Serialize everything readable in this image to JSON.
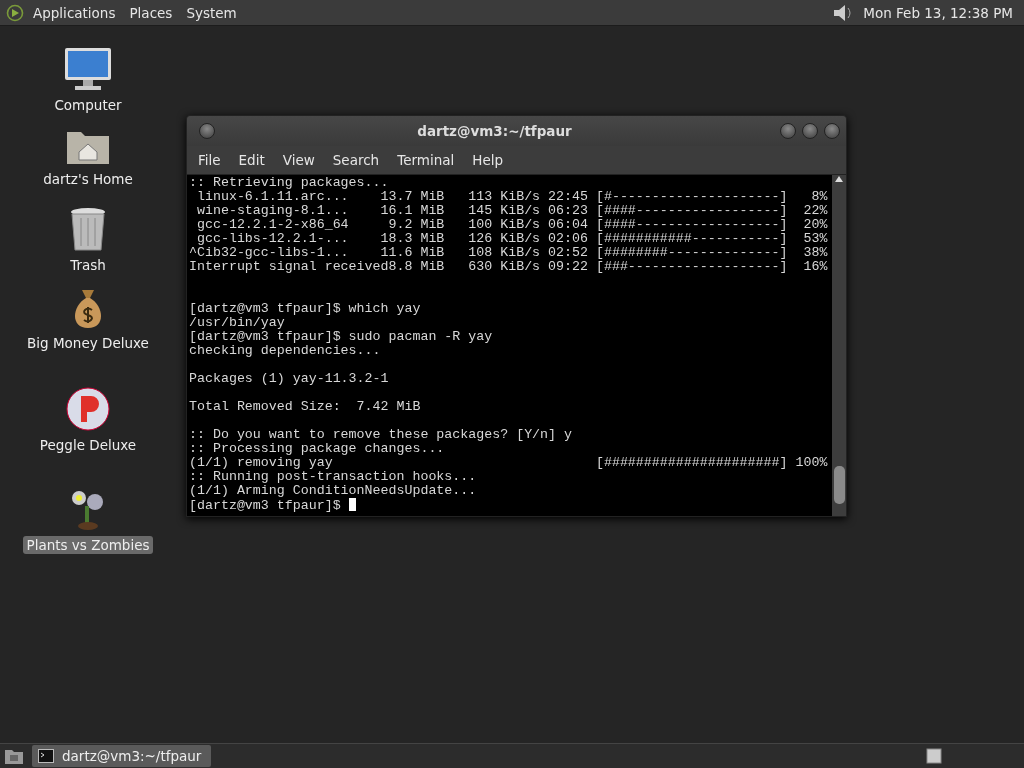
{
  "top_panel": {
    "menus": [
      "Applications",
      "Places",
      "System"
    ],
    "clock": "Mon Feb 13, 12:38 PM"
  },
  "desktop_icons": [
    {
      "label": "Computer",
      "kind": "system",
      "selected": false
    },
    {
      "label": "dartz's Home",
      "kind": "system",
      "selected": false
    },
    {
      "label": "Trash",
      "kind": "system",
      "selected": false
    },
    {
      "label": "Big Money Deluxe",
      "kind": "launcher",
      "selected": false
    },
    {
      "label": "Peggle Deluxe",
      "kind": "launcher",
      "selected": false
    },
    {
      "label": "Plants vs Zombies",
      "kind": "launcher",
      "selected": true
    }
  ],
  "window": {
    "title": "dartz@vm3:~/tfpaur",
    "menu": [
      "File",
      "Edit",
      "View",
      "Search",
      "Terminal",
      "Help"
    ],
    "terminal": {
      "blocks": [
        {
          "kind": "first",
          "lines": [
            ":: Retrieving packages...",
            " linux-6.1.11.arc...    13.7 MiB   113 KiB/s 22:45 [#---------------------]   8%",
            " wine-staging-8.1...    16.1 MiB   145 KiB/s 06:23 [####------------------]  22%",
            " gcc-12.2.1-2-x86_64     9.2 MiB   100 KiB/s 06:04 [####------------------]  20%",
            " gcc-libs-12.2.1-...    18.3 MiB   126 KiB/s 02:06 [###########-----------]  53%",
            "^Cib32-gcc-libs-1...    11.6 MiB   108 KiB/s 02:52 [########--------------]  38%",
            "Interrupt signal received8.8 MiB   630 KiB/s 09:22 [###-------------------]  16%"
          ]
        },
        {
          "kind": "widegap",
          "lines": [
            "[dartz@vm3 tfpaur]$ which yay",
            "/usr/bin/yay",
            "[dartz@vm3 tfpaur]$ sudo pacman -R yay",
            "checking dependencies..."
          ]
        },
        {
          "kind": "gap",
          "lines": [
            "Packages (1) yay-11.3.2-1"
          ]
        },
        {
          "kind": "gap",
          "lines": [
            "Total Removed Size:  7.42 MiB"
          ]
        },
        {
          "kind": "gap",
          "lines": [
            ":: Do you want to remove these packages? [Y/n] y",
            ":: Processing package changes...",
            "(1/1) removing yay                                 [######################] 100%",
            ":: Running post-transaction hooks...",
            "(1/1) Arming ConditionNeedsUpdate..."
          ]
        }
      ],
      "prompt": "[dartz@vm3 tfpaur]$ ",
      "cursor": true
    }
  },
  "taskbar": {
    "tasks": [
      {
        "label": "dartz@vm3:~/tfpaur",
        "selected": true
      }
    ]
  }
}
